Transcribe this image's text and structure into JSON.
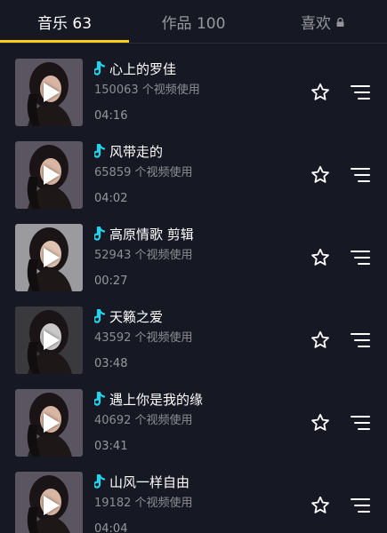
{
  "tabs": [
    {
      "label": "音乐 63",
      "active": true
    },
    {
      "label": "作品 100",
      "active": false
    },
    {
      "label": "喜欢",
      "active": false,
      "icon": "lock-icon"
    }
  ],
  "colors": {
    "background": "#161823",
    "tab_underline": "#face15",
    "note_icon": "#20d5ec"
  },
  "songs": [
    {
      "title": "心上的罗佳",
      "usage": "150063 个视频使用",
      "duration": "04:16"
    },
    {
      "title": "风带走的",
      "usage": "65859 个视频使用",
      "duration": "04:02"
    },
    {
      "title": "高原情歌 剪辑",
      "usage": "52943 个视频使用",
      "duration": "00:27"
    },
    {
      "title": "天籁之爱",
      "usage": "43592 个视频使用",
      "duration": "03:48"
    },
    {
      "title": "遇上你是我的缘",
      "usage": "40692 个视频使用",
      "duration": "03:41"
    },
    {
      "title": "山风一样自由",
      "usage": "19182 个视频使用",
      "duration": "04:04"
    }
  ],
  "icons": {
    "favorite": "star-outline-icon",
    "more": "menu-lines-icon",
    "play": "play-icon",
    "music": "music-note-icon"
  }
}
